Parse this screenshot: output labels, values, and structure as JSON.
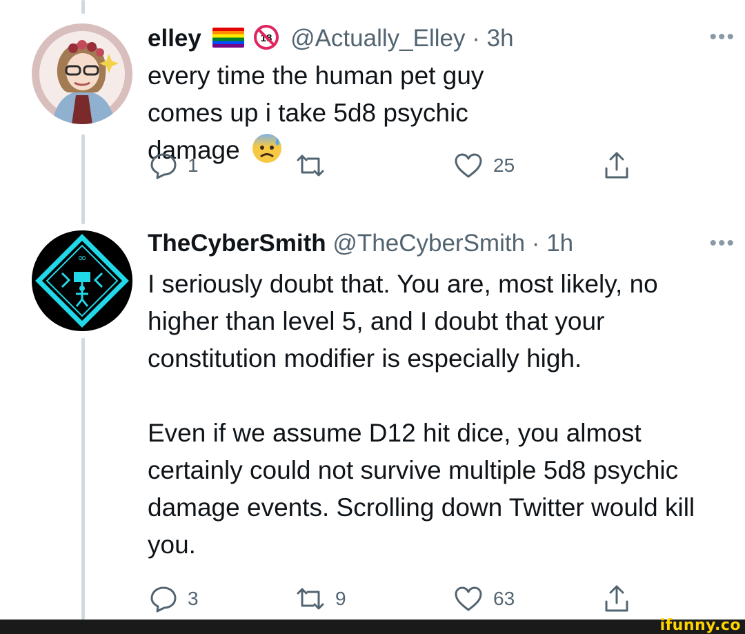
{
  "tweets": [
    {
      "name": "elley",
      "handle": "@Actually_Elley",
      "separator": "·",
      "time": "3h",
      "more": "•••",
      "text": "every time the human pet guy comes up i take 5d8 psychic damage",
      "badges": [
        "rainbow-flag-emoji",
        "no-one-under-18-emoji"
      ],
      "trailing_emoji": "anxious-face-with-sweat-emoji",
      "actions": {
        "reply": "1",
        "retweet": "",
        "like": "25"
      }
    },
    {
      "name": "TheCyberSmith",
      "handle": "@TheCyberSmith",
      "separator": "·",
      "time": "1h",
      "more": "•••",
      "paragraphs": [
        "I seriously doubt that. You are, most likely, no higher than level 5, and I doubt that your constitution modifier is especially high.",
        "Even if we assume D12 hit dice, you almost certainly could not survive multiple 5d8 psychic damage events. Scrolling down Twitter would kill you."
      ],
      "actions": {
        "reply": "3",
        "retweet": "9",
        "like": "63"
      }
    }
  ],
  "watermark": "ifunny.co",
  "colors": {
    "text": "#0f1419",
    "muted": "#536471",
    "thread_line": "#cfd9de",
    "cyan": "#20d8e8"
  }
}
